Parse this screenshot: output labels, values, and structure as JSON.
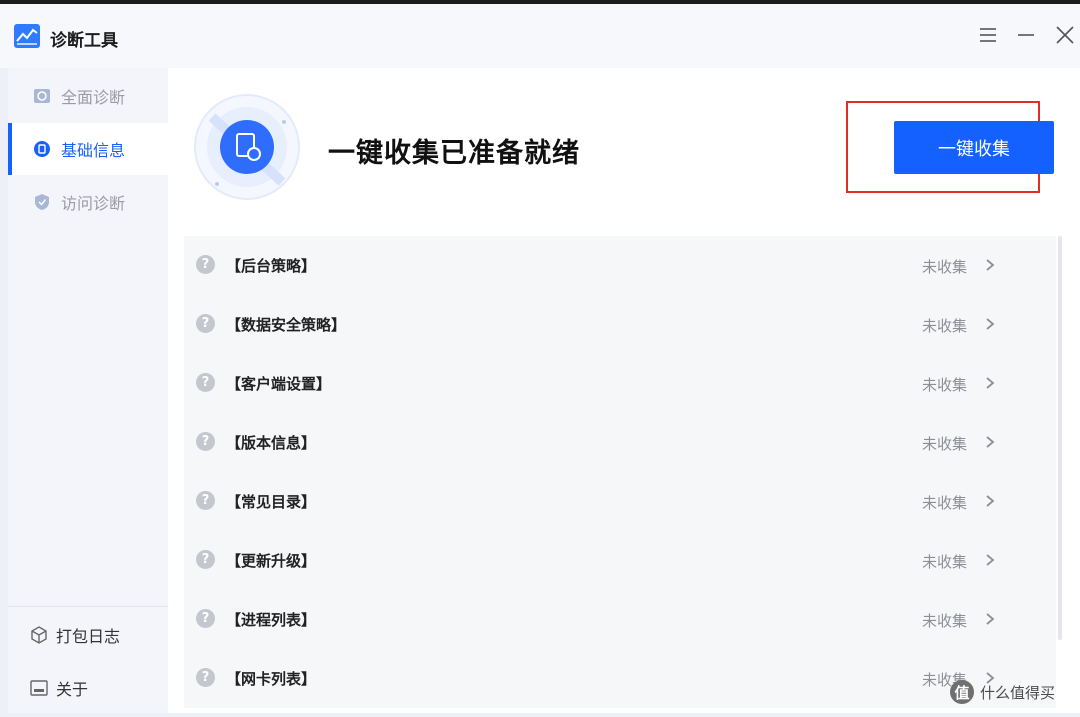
{
  "app": {
    "title": "诊断工具"
  },
  "colors": {
    "accent": "#1461ff",
    "highlight": "#e52a2a",
    "status_text": "#8c8f96"
  },
  "window_controls": [
    "menu-icon",
    "minimize-icon",
    "close-icon"
  ],
  "sidebar": {
    "items": [
      {
        "label": "全面诊断",
        "icon": "full-diagnosis-icon",
        "active": false
      },
      {
        "label": "基础信息",
        "icon": "basic-info-icon",
        "active": true
      },
      {
        "label": "访问诊断",
        "icon": "access-diagnosis-icon",
        "active": false
      }
    ],
    "bottom": [
      {
        "label": "打包日志",
        "icon": "package-icon"
      },
      {
        "label": "关于",
        "icon": "about-icon"
      }
    ]
  },
  "main": {
    "hero_title": "一键收集已准备就绪",
    "collect_button": "一键收集",
    "items": [
      {
        "name": "【后台策略】",
        "status": "未收集"
      },
      {
        "name": "【数据安全策略】",
        "status": "未收集"
      },
      {
        "name": "【客户端设置】",
        "status": "未收集"
      },
      {
        "name": "【版本信息】",
        "status": "未收集"
      },
      {
        "name": "【常见目录】",
        "status": "未收集"
      },
      {
        "name": "【更新升级】",
        "status": "未收集"
      },
      {
        "name": "【进程列表】",
        "status": "未收集"
      },
      {
        "name": "【网卡列表】",
        "status": "未收集"
      }
    ],
    "question_mark": "?"
  },
  "watermark": {
    "logo": "值",
    "text": "什么值得买"
  }
}
